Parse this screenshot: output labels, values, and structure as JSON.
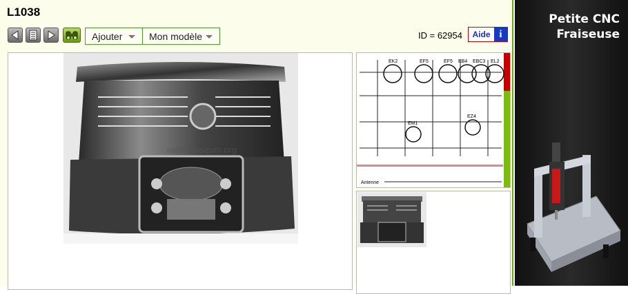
{
  "page": {
    "title": "L1038",
    "id_text": "ID = 62954"
  },
  "toolbar": {
    "prev_icon": "triangle-left-icon",
    "list_icon": "document-list-icon",
    "next_icon": "triangle-right-icon",
    "binocular_icon": "binoculars-icon",
    "ajouter_label": "Ajouter",
    "modele_label": "Mon modèle"
  },
  "help": {
    "label": "Aide",
    "icon_text": "i"
  },
  "photo": {
    "watermark": "radiomuseum.org"
  },
  "schematic": {
    "tubes": [
      "EK2",
      "EF5",
      "EF5",
      "EB4",
      "EBC3",
      "EL2",
      "EM1",
      "EZ4"
    ],
    "antenna_label": "Antenne"
  },
  "ad": {
    "line1": "Petite CNC",
    "line2": "Fraiseuse"
  },
  "colors": {
    "accent_green": "#6aa514",
    "help_blue": "#1838c8",
    "page_bg": "#fdfdec"
  }
}
